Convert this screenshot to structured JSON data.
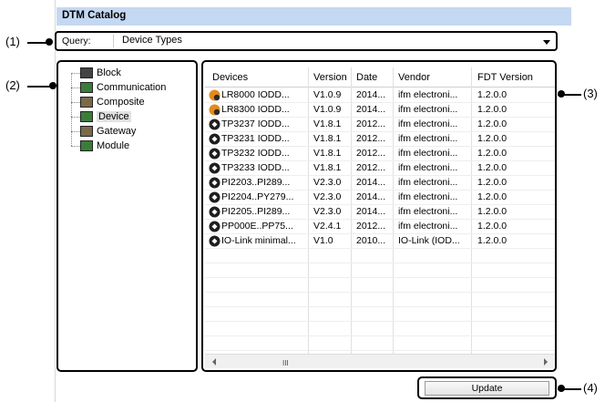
{
  "window": {
    "title": "DTM Catalog"
  },
  "query": {
    "label": "Query:",
    "value": "Device Types"
  },
  "tree": {
    "items": [
      {
        "label": "Block",
        "icon": "block-icon",
        "color": "#444444"
      },
      {
        "label": "Communication",
        "icon": "communication-icon",
        "color": "#3a7d3a"
      },
      {
        "label": "Composite",
        "icon": "composite-icon",
        "color": "#7a6a4a"
      },
      {
        "label": "Device",
        "icon": "device-icon",
        "color": "#3a7d3a",
        "selected": true
      },
      {
        "label": "Gateway",
        "icon": "gateway-icon",
        "color": "#7a6a4a"
      },
      {
        "label": "Module",
        "icon": "module-icon",
        "color": "#3a7d3a"
      }
    ]
  },
  "table": {
    "columns": [
      "Devices",
      "Version",
      "Date",
      "Vendor",
      "FDT Version"
    ],
    "rows": [
      {
        "icon": "lr-sensor-icon",
        "device": "LR8000 IODD...",
        "version": "V1.0.9",
        "date": "2014...",
        "vendor": "ifm electroni...",
        "fdt": "1.2.0.0"
      },
      {
        "icon": "lr-sensor-icon",
        "device": "LR8300 IODD...",
        "version": "V1.0.9",
        "date": "2014...",
        "vendor": "ifm electroni...",
        "fdt": "1.2.0.0"
      },
      {
        "icon": "io-link-icon",
        "device": "TP3237 IODD...",
        "version": "V1.8.1",
        "date": "2012...",
        "vendor": "ifm electroni...",
        "fdt": "1.2.0.0"
      },
      {
        "icon": "io-link-icon",
        "device": "TP3231 IODD...",
        "version": "V1.8.1",
        "date": "2012...",
        "vendor": "ifm electroni...",
        "fdt": "1.2.0.0"
      },
      {
        "icon": "io-link-icon",
        "device": "TP3232 IODD...",
        "version": "V1.8.1",
        "date": "2012...",
        "vendor": "ifm electroni...",
        "fdt": "1.2.0.0"
      },
      {
        "icon": "io-link-icon",
        "device": "TP3233 IODD...",
        "version": "V1.8.1",
        "date": "2012...",
        "vendor": "ifm electroni...",
        "fdt": "1.2.0.0"
      },
      {
        "icon": "io-link-icon",
        "device": "PI2203..PI289...",
        "version": "V2.3.0",
        "date": "2014...",
        "vendor": "ifm electroni...",
        "fdt": "1.2.0.0"
      },
      {
        "icon": "io-link-icon",
        "device": "PI2204..PY279...",
        "version": "V2.3.0",
        "date": "2014...",
        "vendor": "ifm electroni...",
        "fdt": "1.2.0.0"
      },
      {
        "icon": "io-link-icon",
        "device": "PI2205..PI289...",
        "version": "V2.3.0",
        "date": "2014...",
        "vendor": "ifm electroni...",
        "fdt": "1.2.0.0"
      },
      {
        "icon": "io-link-icon",
        "device": "PP000E..PP75...",
        "version": "V2.4.1",
        "date": "2012...",
        "vendor": "ifm electroni...",
        "fdt": "1.2.0.0"
      },
      {
        "icon": "io-link-icon",
        "device": "IO-Link minimal...",
        "version": "V1.0",
        "date": "2010...",
        "vendor": "IO-Link (IOD...",
        "fdt": "1.2.0.0"
      }
    ],
    "scroll_grip": "III"
  },
  "buttons": {
    "update": "Update"
  },
  "callouts": {
    "c1": "(1)",
    "c2": "(2)",
    "c3": "(3)",
    "c4": "(4)"
  }
}
